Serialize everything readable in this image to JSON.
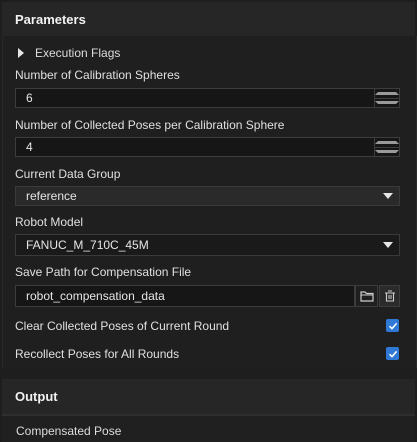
{
  "parameters": {
    "title": "Parameters",
    "execution_flags": "Execution Flags",
    "num_spheres": {
      "label": "Number of Calibration Spheres",
      "value": "6"
    },
    "num_poses": {
      "label": "Number of Collected Poses per Calibration Sphere",
      "value": "4"
    },
    "data_group": {
      "label": "Current Data Group",
      "value": "reference"
    },
    "robot_model": {
      "label": "Robot Model",
      "value": "FANUC_M_710C_45M"
    },
    "save_path": {
      "label": "Save Path for Compensation File",
      "value": "robot_compensation_data"
    },
    "clear_poses": {
      "label": "Clear Collected Poses of Current Round",
      "checked": true
    },
    "recollect_poses": {
      "label": "Recollect Poses for All Rounds",
      "checked": true
    }
  },
  "output": {
    "title": "Output",
    "compensated_pose": "Compensated Pose"
  },
  "colors": {
    "accent": "#2f78d6",
    "background": "#1e1e1e"
  },
  "icons": [
    "chevron-right-icon",
    "spin-up-icon",
    "spin-down-icon",
    "dropdown-arrow-icon",
    "folder-icon",
    "clear-path-icon",
    "check-icon"
  ]
}
